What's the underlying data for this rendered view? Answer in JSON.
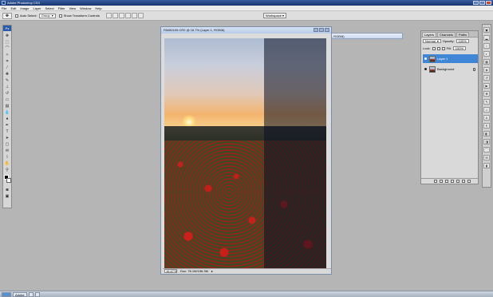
{
  "app": {
    "title": "Adobe Photoshop CS3"
  },
  "menubar": {
    "items": [
      "File",
      "Edit",
      "Image",
      "Layer",
      "Select",
      "Filter",
      "View",
      "Window",
      "Help"
    ]
  },
  "options": {
    "auto_select_label": "Auto Select:",
    "auto_select_value": "Group",
    "show_transform_label": "Show Transform Controls",
    "workspace_label": "Workspace ▾"
  },
  "document": {
    "title": "PA080109.CR2 @ 16.7% (Layer 1, RGB/8)",
    "zoom": "16.67%",
    "doc_info": "Doc: 78.1M/156.3M"
  },
  "document2": {
    "title": "C:\\Users\\...\\PA080109.CR2 @ 16.7% (Layer 1, RGB/8)"
  },
  "layers_panel": {
    "tabs": [
      "Layers",
      "Channels",
      "Paths"
    ],
    "blend_mode": "Normal",
    "opacity_label": "Opacity:",
    "opacity_value": "100%",
    "lock_label": "Lock:",
    "fill_label": "Fill:",
    "fill_value": "100%",
    "layers": [
      {
        "name": "Layer 1",
        "selected": true
      },
      {
        "name": "Background",
        "selected": false
      }
    ]
  },
  "taskbar": {
    "items": [
      "Adobe"
    ]
  },
  "colors": {
    "selection": "#3f86d6",
    "titlebar": "#16356f"
  }
}
